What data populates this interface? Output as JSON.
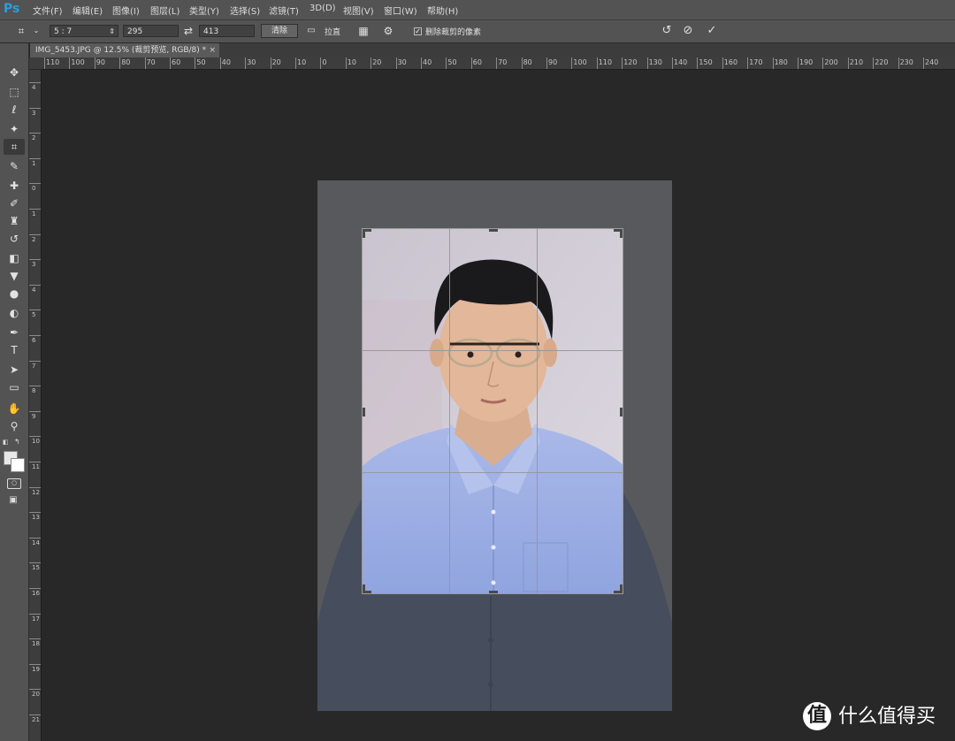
{
  "app": {
    "logo": "Ps"
  },
  "menu": {
    "items": [
      "文件(F)",
      "编辑(E)",
      "图像(I)",
      "图层(L)",
      "类型(Y)",
      "选择(S)",
      "滤镜(T)",
      "3D(D)",
      "视图(V)",
      "窗口(W)",
      "帮助(H)"
    ]
  },
  "options": {
    "ratio": "5 : 7",
    "width": "295",
    "height": "413",
    "clear_label": "清除",
    "straighten_label": "拉直",
    "delete_cropped_label": "删除裁剪的像素",
    "delete_cropped_checked": true
  },
  "document": {
    "tab_title": "IMG_5453.JPG @ 12.5% (裁剪预览, RGB/8) *",
    "close_glyph": "×"
  },
  "ruler": {
    "top_ticks": [
      "110",
      "100",
      "90",
      "80",
      "70",
      "60",
      "50",
      "40",
      "30",
      "20",
      "10",
      "0",
      "10",
      "20",
      "30",
      "40",
      "50",
      "60",
      "70",
      "80",
      "90",
      "100",
      "110",
      "120",
      "130",
      "140",
      "150",
      "160",
      "170",
      "180",
      "190",
      "200",
      "210",
      "220",
      "230",
      "240"
    ],
    "left_ticks": [
      "4",
      "3",
      "2",
      "1",
      "0",
      "1",
      "2",
      "3",
      "4",
      "5",
      "6",
      "7",
      "8",
      "9",
      "10",
      "11",
      "12",
      "13",
      "14",
      "15",
      "16",
      "17",
      "18",
      "19",
      "20",
      "21"
    ]
  },
  "tools": [
    {
      "name": "move-tool",
      "glyph": "✥"
    },
    {
      "name": "marquee-tool",
      "glyph": "⬚"
    },
    {
      "name": "lasso-tool",
      "glyph": "ℓ"
    },
    {
      "name": "magic-wand-tool",
      "glyph": "✦"
    },
    {
      "name": "crop-tool",
      "glyph": "⌗"
    },
    {
      "name": "eyedropper-tool",
      "glyph": "✎"
    },
    {
      "name": "healing-brush-tool",
      "glyph": "✚"
    },
    {
      "name": "brush-tool",
      "glyph": "✐"
    },
    {
      "name": "clone-stamp-tool",
      "glyph": "♜"
    },
    {
      "name": "history-brush-tool",
      "glyph": "↺"
    },
    {
      "name": "eraser-tool",
      "glyph": "◧"
    },
    {
      "name": "paint-bucket-tool",
      "glyph": "▼"
    },
    {
      "name": "blur-tool",
      "glyph": "●"
    },
    {
      "name": "dodge-tool",
      "glyph": "◐"
    },
    {
      "name": "pen-tool",
      "glyph": "✒"
    },
    {
      "name": "type-tool",
      "glyph": "T"
    },
    {
      "name": "path-selection-tool",
      "glyph": "➤"
    },
    {
      "name": "rectangle-tool",
      "glyph": "▭"
    },
    {
      "name": "hand-tool",
      "glyph": "✋"
    },
    {
      "name": "zoom-tool",
      "glyph": "⚲"
    }
  ],
  "watermark": {
    "icon_glyph": "值",
    "text": "什么值得买"
  },
  "colors": {
    "chrome": "#535353",
    "canvas": "#282828",
    "accent": "#2d9cdb"
  }
}
